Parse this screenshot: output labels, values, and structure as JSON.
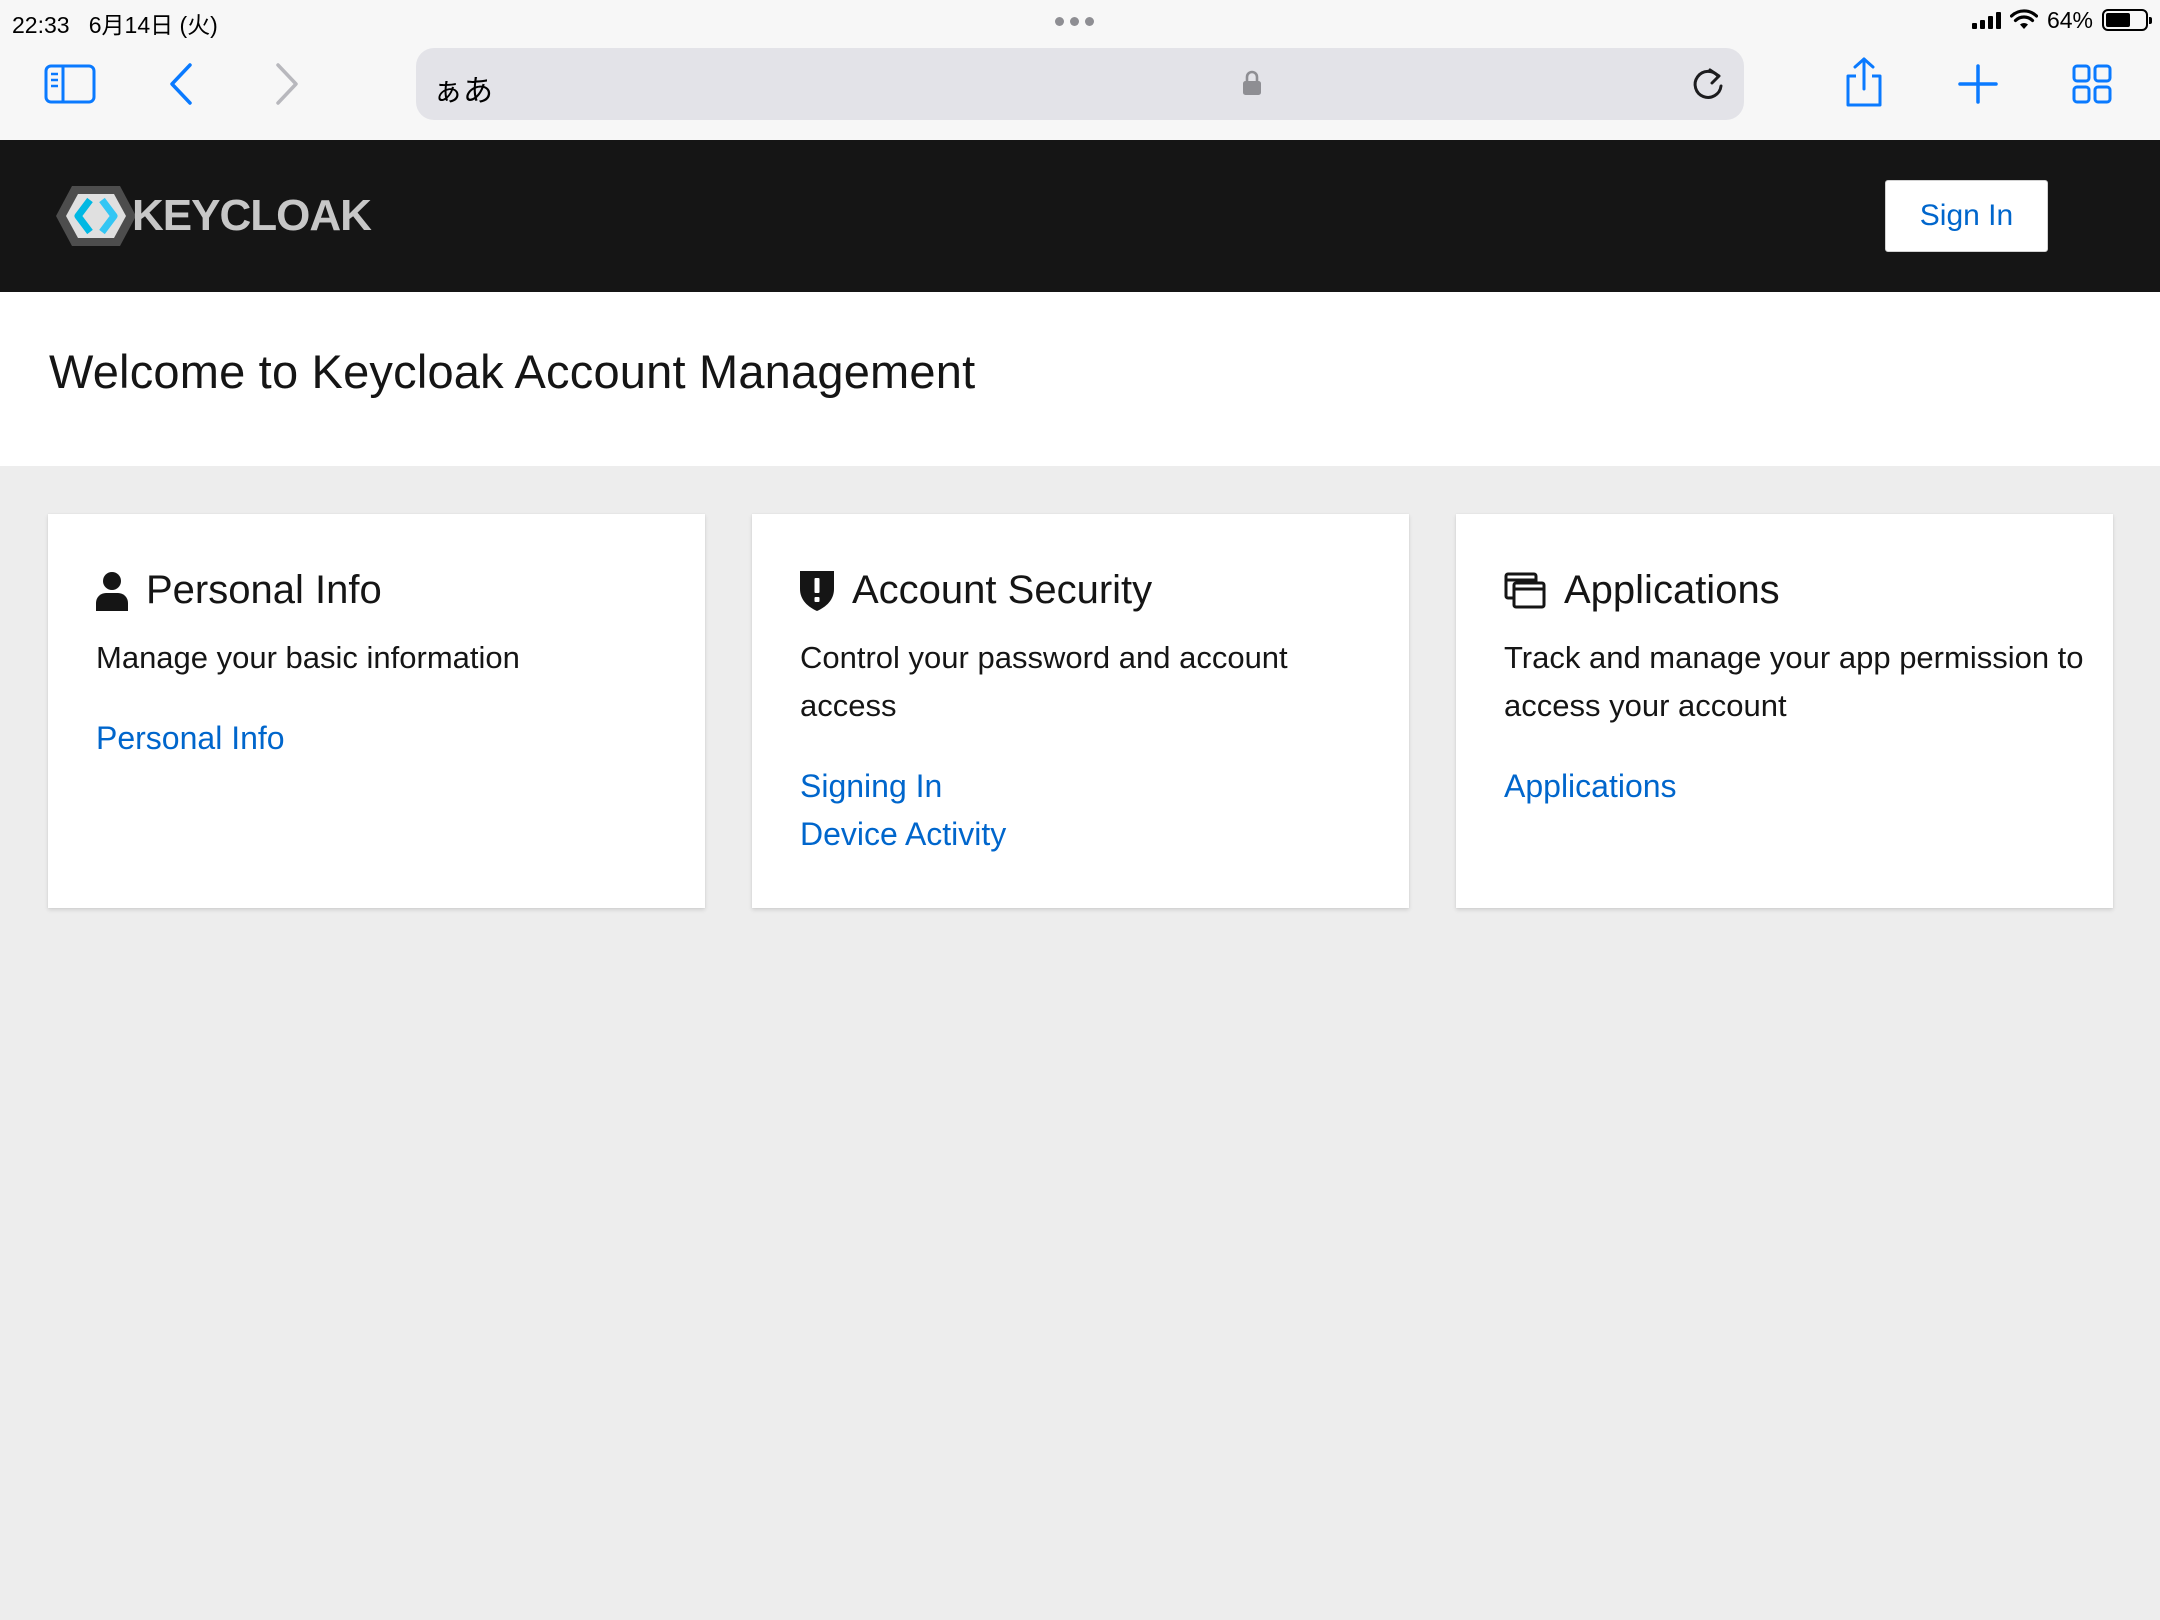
{
  "status_bar": {
    "time": "22:33",
    "date": "6月14日 (火)",
    "battery_percent": "64%",
    "battery_level": 0.64
  },
  "browser": {
    "url_text": "ぁあ",
    "icons": [
      "sidebar-icon",
      "back-icon",
      "forward-icon",
      "lock-icon",
      "reload-icon",
      "share-icon",
      "new-tab-icon",
      "tabs-overview-icon"
    ]
  },
  "header": {
    "logo_text": "KEYCLOAK",
    "sign_in_label": "Sign In",
    "colors": {
      "background": "#151515",
      "link": "#0066cc"
    }
  },
  "welcome": {
    "title": "Welcome to Keycloak Account Management"
  },
  "cards": [
    {
      "icon": "user-icon",
      "title": "Personal Info",
      "description": "Manage your basic information",
      "links": [
        "Personal Info"
      ]
    },
    {
      "icon": "shield-alert-icon",
      "title": "Account Security",
      "description": "Control your password and account access",
      "links": [
        "Signing In",
        "Device Activity"
      ]
    },
    {
      "icon": "applications-icon",
      "title": "Applications",
      "description": "Track and manage your app permission to access your account",
      "links": [
        "Applications"
      ]
    }
  ]
}
